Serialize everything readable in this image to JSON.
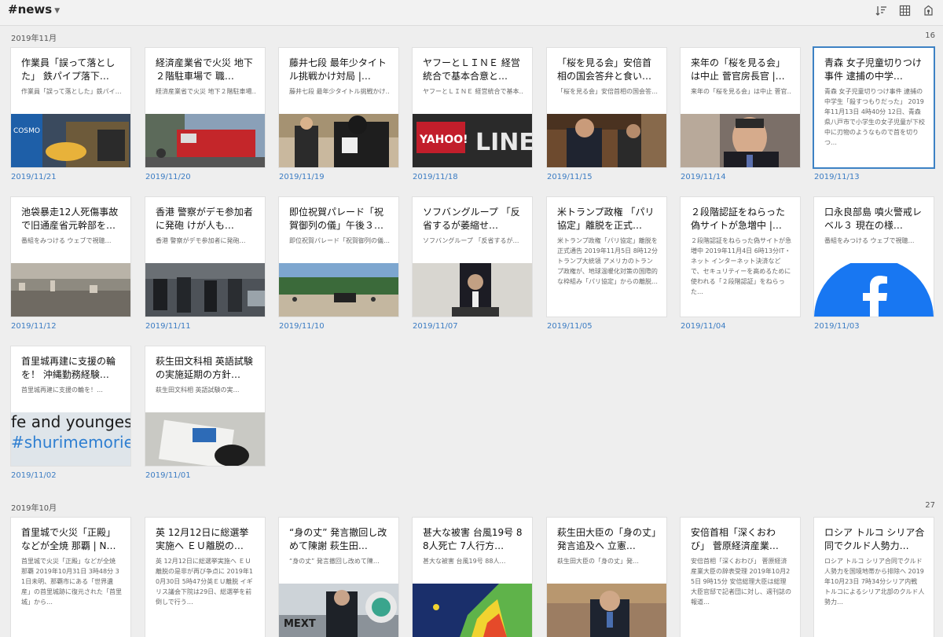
{
  "header": {
    "title": "#news",
    "tool_icons": [
      "sort-icon",
      "grid-view-icon",
      "share-icon"
    ]
  },
  "sections": [
    {
      "label": "2019年11月",
      "count": "16",
      "cards": [
        {
          "title": "作業員「誤って落とした」 鉄パイプ落下…",
          "snippet": "作業員「誤って落とした」鉄パイ…",
          "date": "2019/11/21",
          "thumb": "thumb-cosmo"
        },
        {
          "title": "経済産業省で火災 地下２階駐車場で 職…",
          "snippet": "経済産業省で火災 地下２階駐車場…",
          "date": "2019/11/20",
          "thumb": "thumb-firetruck"
        },
        {
          "title": "藤井七段 最年少タイトル挑戦かけ対局 |…",
          "snippet": "藤井七段 最年少タイトル挑戦かけ…",
          "date": "2019/11/19",
          "thumb": "thumb-shogi"
        },
        {
          "title": "ヤフーとＬＩＮＥ 経営統合で基本合意と…",
          "snippet": "ヤフーとＬＩＮＥ 経営統合で基本…",
          "date": "2019/11/18",
          "thumb": "thumb-yahoo-line"
        },
        {
          "title": "「桜を見る会」安倍首相の国会答弁と食い…",
          "snippet": "「桜を見る会」安倍首相の国会答…",
          "date": "2019/11/15",
          "thumb": "thumb-diet"
        },
        {
          "title": "来年の「桜を見る会」は中止 菅官房長官 |…",
          "snippet": "来年の「桜を見る会」は中止 菅官…",
          "date": "2019/11/14",
          "thumb": "thumb-abe"
        },
        {
          "title": "青森 女子児童切りつけ事件 逮捕の中学…",
          "snippet": "青森 女子児童切りつけ事件 逮捕の中学生「殺すつもりだった」 2019年11月13日 4時40分 12日、青森県八戸市で小学生の女子児童が下校中に刃物のようなもので首を切りつ…",
          "long": true,
          "date": "2019/11/13",
          "thumb": "none",
          "selected": true
        },
        {
          "title": "池袋暴走12人死傷事故で旧通産省元幹部を…",
          "snippet": "番組をみつける ウェブで視聴…",
          "date": "2019/11/12",
          "thumb": "thumb-city"
        },
        {
          "title": "香港 警察がデモ参加者に発砲 けが人も…",
          "snippet": "香港 警察がデモ参加者に発砲…",
          "date": "2019/11/11",
          "thumb": "thumb-hongkong"
        },
        {
          "title": "即位祝賀パレード「祝賀御列の儀」午後３…",
          "snippet": "即位祝賀パレード「祝賀御列の儀…",
          "date": "2019/11/10",
          "thumb": "thumb-parade"
        },
        {
          "title": "ソフバングループ 「反省するが萎縮せ…",
          "snippet": "ソフバングループ 「反省するが…",
          "date": "2019/11/07",
          "thumb": "thumb-softbank"
        },
        {
          "title": "米トランプ政権 「パリ協定」離脱を正式…",
          "snippet": "米トランプ政権「パリ協定」離脱を正式通告 2019年11月5日 8時12分トランプ大統領 アメリカのトランプ政権が、地球温暖化対策の国際的な枠組み「パリ協定」からの離脱…",
          "long": true,
          "date": "2019/11/05",
          "thumb": "none"
        },
        {
          "title": "２段階認証をねらった偽サイトが急増中 |…",
          "snippet": "２段階認証をねらった偽サイトが急増中 2019年11月4日 6時13分IT・ネット インターネット決済などで、セキュリティーを高めるために使われる「２段階認証」をねらった…",
          "long": true,
          "date": "2019/11/04",
          "thumb": "none"
        },
        {
          "title": "口永良部島 噴火警戒レベル３ 現在の様…",
          "snippet": "番組をみつける ウェブで視聴…",
          "date": "2019/11/03",
          "thumb": "thumb-facebook"
        },
        {
          "title": "首里城再建に支援の輪を！ 沖縄勤務経験…",
          "snippet": "首里城再建に支援の輪を！…",
          "date": "2019/11/02",
          "thumb": "thumb-shuri",
          "thumb_text_1": "fe and youngest",
          "thumb_text_2": "#shurimemories"
        },
        {
          "title": "萩生田文科相 英語試験の実施延期の方針…",
          "snippet": "萩生田文科相 英語試験の実…",
          "date": "2019/11/01",
          "thumb": "thumb-exam"
        }
      ]
    },
    {
      "label": "2019年10月",
      "count": "27",
      "cards": [
        {
          "title": "首里城で火災「正殿」などが全焼 那覇 | N…",
          "snippet": "首里城で火災「正殿」などが全焼 那覇 2019年10月31日 3時48分 31日未明、那覇市にある「世界遺産」の首里城跡に復元された「首里城」から…",
          "long": true,
          "thumb": "none"
        },
        {
          "title": "英 12月12日に総選挙実施へ ＥＵ離脱の…",
          "snippet": "英 12月12日に総選挙実施へ ＥＵ離脱の是非が再び争点に 2019年10月30日 5時47分英ＥＵ離脱 イギリス議会下院は29日、総選挙を前倒しで行う…",
          "long": true,
          "thumb": "none"
        },
        {
          "title": "“身の丈” 発言撤回し改めて陳謝 萩生田…",
          "snippet": "“身の丈” 発言撤回し改めて陳…",
          "thumb": "thumb-mext",
          "thumb_text_1": "MEXT"
        },
        {
          "title": "甚大な被害 台風19号 88人死亡 7人行方…",
          "snippet": "甚大な被害 台風19号 88人…",
          "thumb": "thumb-map"
        },
        {
          "title": "萩生田大臣の「身の丈」発言追及へ 立憲…",
          "snippet": "萩生田大臣の「身の丈」発…",
          "thumb": "thumb-minister"
        },
        {
          "title": "安倍首相「深くおわび」 菅原経済産業…",
          "snippet": "安倍首相「深くおわび」 菅原経済産業大臣の辞表受理 2019年10月25日 9時15分 安倍総理大臣は総理大臣官邸で記者団に対し、週刊誌の報道…",
          "long": true,
          "thumb": "none"
        },
        {
          "title": "ロシア トルコ シリア合同でクルド人勢力…",
          "snippet": "ロシア トルコ シリア合同でクルド人勢力を国境地帯から排除へ 2019年10月23日 7時34分シリア内戦 トルコによるシリア北部のクルド人勢力…",
          "long": true,
          "thumb": "none"
        }
      ]
    }
  ]
}
